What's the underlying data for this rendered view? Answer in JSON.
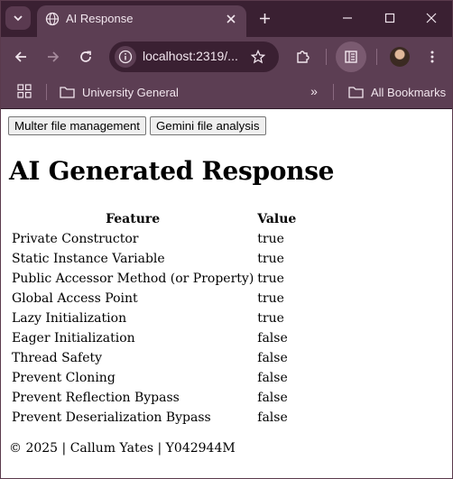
{
  "browser": {
    "tab": {
      "title": "AI Response"
    },
    "address": {
      "url": "localhost:2319/..."
    },
    "bookmarks": [
      {
        "label": "University General"
      }
    ],
    "all_bookmarks_label": "All Bookmarks",
    "more_label": "»"
  },
  "page": {
    "buttons": {
      "multer": "Multer file management",
      "gemini": "Gemini file analysis"
    },
    "heading": "AI Generated Response",
    "table": {
      "headers": {
        "feature": "Feature",
        "value": "Value"
      },
      "rows": [
        {
          "feature": "Private Constructor",
          "value": "true"
        },
        {
          "feature": "Static Instance Variable",
          "value": "true"
        },
        {
          "feature": "Public Accessor Method (or Property)",
          "value": "true"
        },
        {
          "feature": "Global Access Point",
          "value": "true"
        },
        {
          "feature": "Lazy Initialization",
          "value": "true"
        },
        {
          "feature": "Eager Initialization",
          "value": "false"
        },
        {
          "feature": "Thread Safety",
          "value": "false"
        },
        {
          "feature": "Prevent Cloning",
          "value": "false"
        },
        {
          "feature": "Prevent Reflection Bypass",
          "value": "false"
        },
        {
          "feature": "Prevent Deserialization Bypass",
          "value": "false"
        }
      ]
    },
    "footer": "© 2025 | Callum Yates | Y042944M"
  },
  "colors": {
    "titlebar": "#3a2032",
    "toolbar": "#5c3e53",
    "toolbar_text": "#f2e6ee"
  }
}
